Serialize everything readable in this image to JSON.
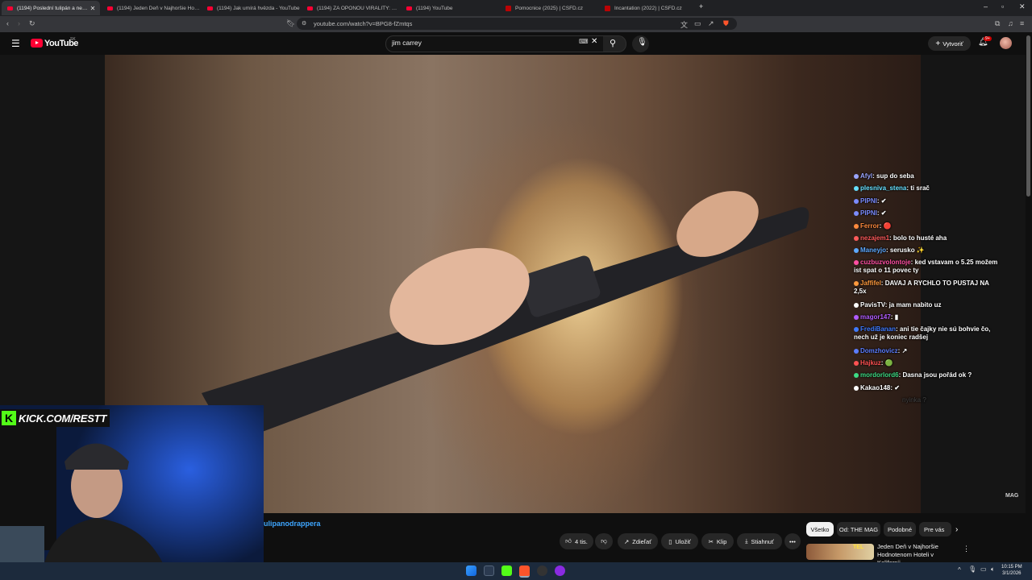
{
  "browser": {
    "tabs": [
      {
        "title": "(1194) Poslední tulipán a neží…",
        "favicon": "youtube-icon",
        "active": true
      },
      {
        "title": "(1194) Jeden Deň v Najhoršie Hodno…",
        "favicon": "youtube-icon"
      },
      {
        "title": "(1194) Jak umírá hvězda - YouTube",
        "favicon": "youtube-icon"
      },
      {
        "title": "(1194) ZA OPONOU VIRALITY: MELT…",
        "favicon": "youtube-icon"
      },
      {
        "title": "(1194) YouTube",
        "favicon": "youtube-icon"
      },
      {
        "title": "Pomocnice (2025) | ČSFD.cz",
        "favicon": "csfd-icon"
      },
      {
        "title": "Incantation (2022) | ČSFD.cz",
        "favicon": "csfd-icon"
      }
    ],
    "url": "youtube.com/watch?v=BPG8-fZmtqs"
  },
  "youtube": {
    "logo_text": "YouTube",
    "region": "SK",
    "search_value": "jim carrey",
    "create_label": "Vytvoriť",
    "notification_count": "9+"
  },
  "video": {
    "watermark": "MAG"
  },
  "chat": [
    {
      "user": "Afyl",
      "msg": "sup do seba",
      "color": "#9aa5ff"
    },
    {
      "user": "plesniva_stena",
      "msg": "ti srač",
      "color": "#66e0ff"
    },
    {
      "user": "PIPNI",
      "msg": "✔",
      "color": "#7b8cff"
    },
    {
      "user": "PIPNI",
      "msg": "✔",
      "color": "#7b8cff"
    },
    {
      "user": "Ferror",
      "msg": "🔴",
      "color": "#ff8a3d"
    },
    {
      "user": "nezajem1",
      "msg": "bolo to husté aha",
      "color": "#ff5b5b"
    },
    {
      "user": "Maneyjo",
      "msg": "serusko ✨",
      "color": "#5da9ff"
    },
    {
      "user": "cuzbuzvolontoje",
      "msg": "ked vstavam o 5.25 možem ist spat o 11 povec ty",
      "color": "#ff4fa3",
      "wrap": true
    },
    {
      "user": "Jaffifel",
      "msg": "DAVAJ A RYCHLO TO PUSTAJ NA 2,5x",
      "color": "#ff9a3d",
      "wrap": true
    },
    {
      "user": "PavisTV",
      "msg": "ja mam nabito uz",
      "color": "#ffffff"
    },
    {
      "user": "magor147",
      "msg": "▮",
      "color": "#b05cff"
    },
    {
      "user": "FrediBanan",
      "msg": "ani tie čajky nie sú bohvie čo, nech už je koniec radšej",
      "color": "#3f7bff",
      "wrap": true
    },
    {
      "user": "Domzhovicz",
      "msg": "↗",
      "color": "#5b7dff"
    },
    {
      "user": "Hajkuz",
      "msg": "🟢",
      "color": "#ff5252"
    },
    {
      "user": "mordorlord6",
      "msg": "Dasna jsou pořád ok ?",
      "color": "#3ddc84"
    },
    {
      "user": "Kakao148",
      "msg": "✔",
      "color": "#ffffff"
    }
  ],
  "chat_faded": "nyinka ?",
  "stream": {
    "kick_url": "KICK.COM/RESTT"
  },
  "below": {
    "channel": "ulipanodrappera",
    "like_count": "4 tis.",
    "share_label": "Zdieľať",
    "save_label": "Uložiť",
    "clip_label": "Klip",
    "download_label": "Stiahnuť"
  },
  "chips": [
    "Všetko",
    "Od: THE MAG",
    "Podobné",
    "Pre vás"
  ],
  "recommendation": {
    "title": "Jeden Deň v Najhoršie Hodnotenom Hoteli v Kalifornii…",
    "thumb_label": "TEL"
  },
  "taskbar": {
    "time": "10:15 PM",
    "date": "3/1/2026"
  },
  "colors": {
    "youtube_red": "#ff0033",
    "link_blue": "#3ea6ff",
    "kick_green": "#53fc18"
  }
}
